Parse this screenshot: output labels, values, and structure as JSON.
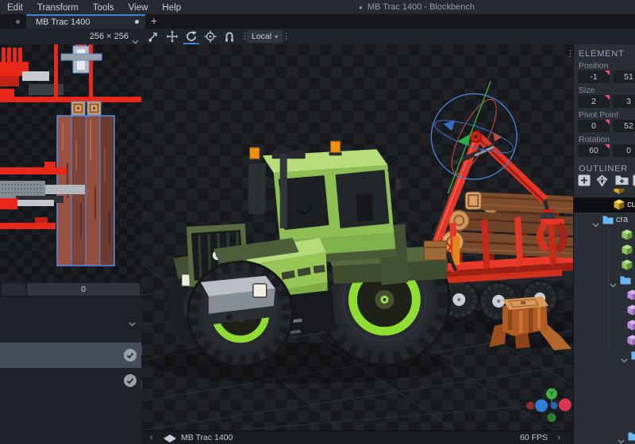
{
  "window": {
    "title_bullet": "●",
    "title": "MB Trac 1400 - Blockbench"
  },
  "menubar": {
    "items": [
      "Edit",
      "Transform",
      "Tools",
      "View",
      "Help"
    ]
  },
  "tabbar": {
    "active_tab": "MB Trac 1400",
    "new_tab_button": "+"
  },
  "uv_panel": {
    "resolution": "256 × 256",
    "slider_value": "0"
  },
  "viewport_toolbar": {
    "tools": [
      "scale",
      "move",
      "rotate",
      "pivot",
      "vertex-snap"
    ],
    "active_tool": "rotate",
    "space_mode": "Local",
    "overflow_dots": "⋮"
  },
  "element_panel": {
    "header": "ELEMENT",
    "groups": [
      {
        "label": "Position",
        "values": [
          "-1",
          "51"
        ]
      },
      {
        "label": "Size",
        "values": [
          "2",
          "3"
        ]
      },
      {
        "label": "Pivot Point",
        "values": [
          "0",
          "52"
        ]
      },
      {
        "label": "Rotation",
        "values": [
          "60",
          "0"
        ]
      }
    ]
  },
  "outliner_panel": {
    "header": "OUTLINER",
    "tree": [
      {
        "kind": "cube",
        "color": "yellow",
        "label": "",
        "x": 50,
        "clipped": true
      },
      {
        "kind": "cube",
        "color": "yellow",
        "label": "cub",
        "x": 50,
        "selected": true
      },
      {
        "kind": "folder",
        "color": "blue",
        "label": "cra",
        "x": 36,
        "chevron": true
      },
      {
        "kind": "cube",
        "color": "green",
        "label": "",
        "x": 60
      },
      {
        "kind": "cube",
        "color": "green",
        "label": "",
        "x": 60
      },
      {
        "kind": "cube",
        "color": "green",
        "label": "",
        "x": 60
      },
      {
        "kind": "folder",
        "color": "blue",
        "label": "",
        "x": 58,
        "chevron": true
      },
      {
        "kind": "cube",
        "color": "purple",
        "label": "",
        "x": 67
      },
      {
        "kind": "cube",
        "color": "purple",
        "label": "",
        "x": 67
      },
      {
        "kind": "cube",
        "color": "purple",
        "label": "",
        "x": 67
      },
      {
        "kind": "cube",
        "color": "purple",
        "label": "",
        "x": 67
      },
      {
        "kind": "folder",
        "color": "blue",
        "label": "",
        "x": 72,
        "chevron": true
      },
      {
        "kind": "folder",
        "color": "blue",
        "label": "",
        "x": 68,
        "chevron": true,
        "gap_before": 83
      }
    ]
  },
  "textures_panel": {
    "rows": [
      {
        "selected": true
      },
      {
        "selected": false
      }
    ]
  },
  "viewport_status": {
    "model_name": "MB Trac 1400",
    "fps": "60 FPS"
  },
  "nav_gizmo": {
    "y_axis_label": "Y"
  },
  "colors": {
    "accent": "#3d83dc",
    "keyframe_pink": "#ef4f72",
    "folder_blue": "#6cb8f4",
    "cube_yellow": "#f6d85c",
    "cube_green": "#8cc45e",
    "cube_purple": "#b68ad6",
    "tractor_green": "#97c556",
    "rim_lime": "#8fdd33",
    "trailer_red": "#e53727",
    "log_brown": "#7d4c2c",
    "beacon_orange": "#ef9113",
    "uv_selection_blue": "#4f8fe8"
  }
}
